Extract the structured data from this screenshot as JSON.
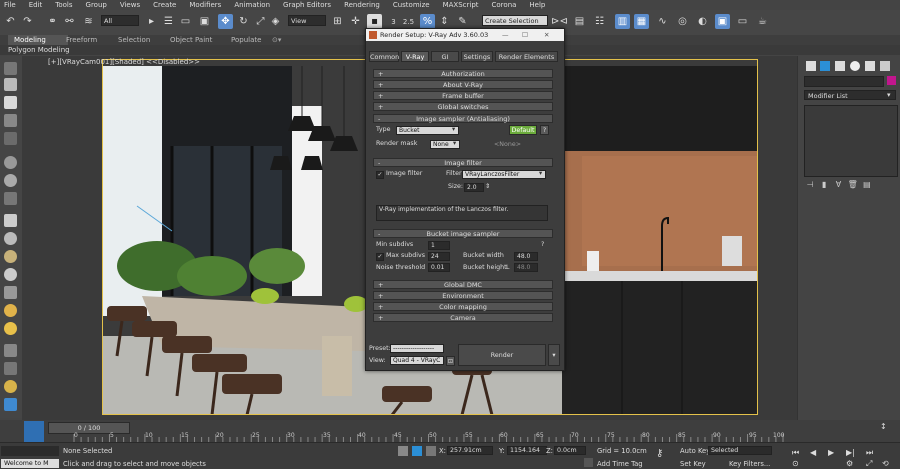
{
  "menubar": {
    "items": [
      "File",
      "Edit",
      "Tools",
      "Group",
      "Views",
      "Create",
      "Modifiers",
      "Animation",
      "Graph Editors",
      "Rendering",
      "Customize",
      "MAXScript",
      "Corona",
      "Help"
    ]
  },
  "toolbar": {
    "filter_select": "All",
    "view_select": "View",
    "angle_snap": "2.5",
    "percent_snap": "%",
    "selection_set_placeholder": "Create Selection Se"
  },
  "ribbon": {
    "tabs": [
      "Modeling",
      "Freeform",
      "Selection",
      "Object Paint",
      "Populate"
    ],
    "active_tab": "Modeling",
    "subpanel": "Polygon Modeling"
  },
  "viewport": {
    "label": "[+][VRayCam001][Shaded] <<Disabled>>"
  },
  "right_panel": {
    "modifier_list": "Modifier List"
  },
  "dialog": {
    "title": "Render Setup: V-Ray Adv 3.60.03",
    "tabs": [
      "Common",
      "V-Ray",
      "GI",
      "Settings",
      "Render Elements"
    ],
    "active_tab": "V-Ray",
    "rollouts_top": [
      "Authorization",
      "About V-Ray",
      "Frame buffer",
      "Global switches"
    ],
    "image_sampler": {
      "header": "Image sampler (Antialiasing)",
      "type_label": "Type",
      "type_value": "Bucket",
      "default_button": "Default",
      "help_button": "?",
      "render_mask_label": "Render mask",
      "render_mask_value": "None",
      "mask_none": "<None>"
    },
    "image_filter": {
      "header": "Image filter",
      "enable_label": "Image filter",
      "filter_label": "Filter",
      "filter_value": "VRayLanczosFilter",
      "size_label": "Size:",
      "size_value": "2.0",
      "description": "V-Ray implementation of the Lanczos filter."
    },
    "bucket_sampler": {
      "header": "Bucket image sampler",
      "min_subdivs_label": "Min subdivs",
      "min_subdivs": "1",
      "max_subdivs_label": "Max subdivs",
      "max_subdivs": "24",
      "noise_threshold_label": "Noise threshold",
      "noise_threshold": "0.01",
      "bucket_width_label": "Bucket width",
      "bucket_width": "48.0",
      "bucket_height_label": "Bucket height",
      "bucket_height": "48.0",
      "lock": "L",
      "help": "?"
    },
    "rollouts_bottom": [
      "Global DMC",
      "Environment",
      "Color mapping",
      "Camera"
    ],
    "preset_label": "Preset:",
    "preset_value": "-------------------",
    "view_label": "View:",
    "view_value": "Quad 4 - VRayC",
    "render_button": "Render"
  },
  "timeline": {
    "slider_label": "0 / 100",
    "ticks": [
      "0",
      "5",
      "10",
      "15",
      "20",
      "25",
      "30",
      "35",
      "40",
      "45",
      "50",
      "55",
      "60",
      "65",
      "70",
      "75",
      "80",
      "85",
      "90",
      "95",
      "100"
    ]
  },
  "statusbar": {
    "maxscript": "Welcome to M",
    "selection_status": "None Selected",
    "prompt": "Click and drag to select and move objects",
    "x_label": "X:",
    "x_value": "257.91cm",
    "y_label": "Y:",
    "y_value": "1154.164",
    "z_label": "Z:",
    "z_value": "0.0cm",
    "grid": "Grid = 10.0cm",
    "add_time_tag": "Add Time Tag",
    "auto_key": "Auto Key",
    "selected": "Selected",
    "set_key": "Set Key",
    "key_filters": "Key Filters..."
  }
}
